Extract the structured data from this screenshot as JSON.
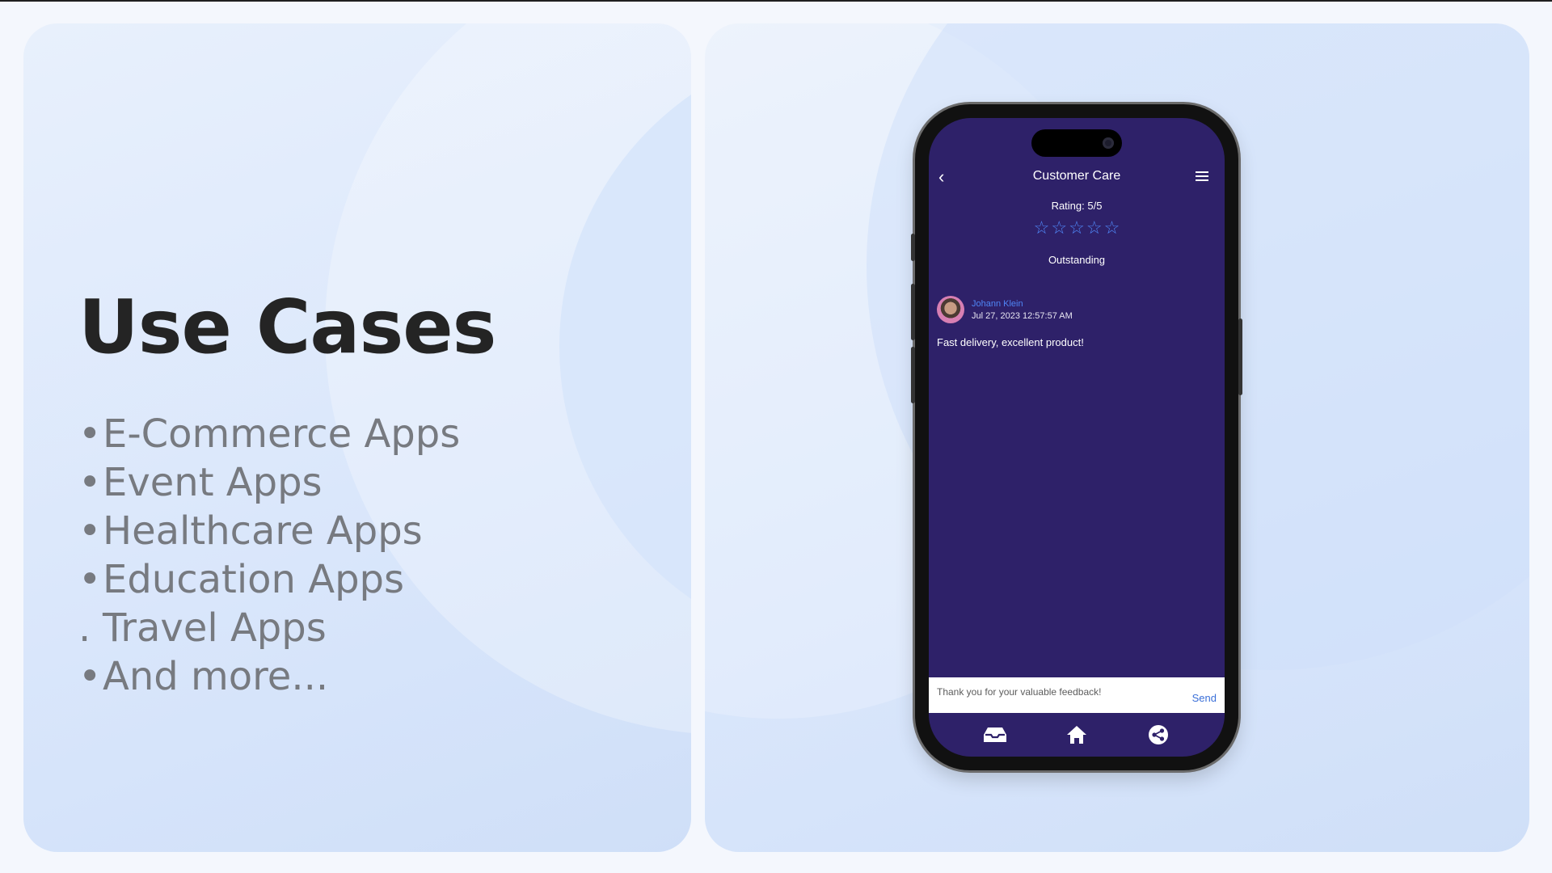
{
  "slide": {
    "title": "Use Cases",
    "use_cases": [
      {
        "bullet": "•",
        "label": "E-Commerce Apps"
      },
      {
        "bullet": "•",
        "label": "Event Apps"
      },
      {
        "bullet": "•",
        "label": "Healthcare Apps"
      },
      {
        "bullet": "•",
        "label": "Education Apps"
      },
      {
        "bullet": ".",
        "label": "Travel Apps"
      },
      {
        "bullet": "•",
        "label": "And more..."
      }
    ]
  },
  "app": {
    "header": {
      "title": "Customer Care",
      "back_icon": "chevron-left-icon",
      "menu_icon": "hamburger-menu-icon"
    },
    "rating": {
      "label": "Rating: 5/5",
      "value": 5,
      "max": 5,
      "word": "Outstanding"
    },
    "review": {
      "author": "Johann Klein",
      "date": "Jul 27, 2023 12:57:57 AM",
      "text": "Fast delivery, excellent product!"
    },
    "reply": {
      "placeholder": "Thank you for your valuable feedback!",
      "send_label": "Send"
    },
    "tabbar": {
      "items": [
        "inbox-icon",
        "home-icon",
        "share-icon"
      ]
    },
    "colors": {
      "screen_bg": "#2e2169",
      "accent": "#4f86f5"
    }
  }
}
